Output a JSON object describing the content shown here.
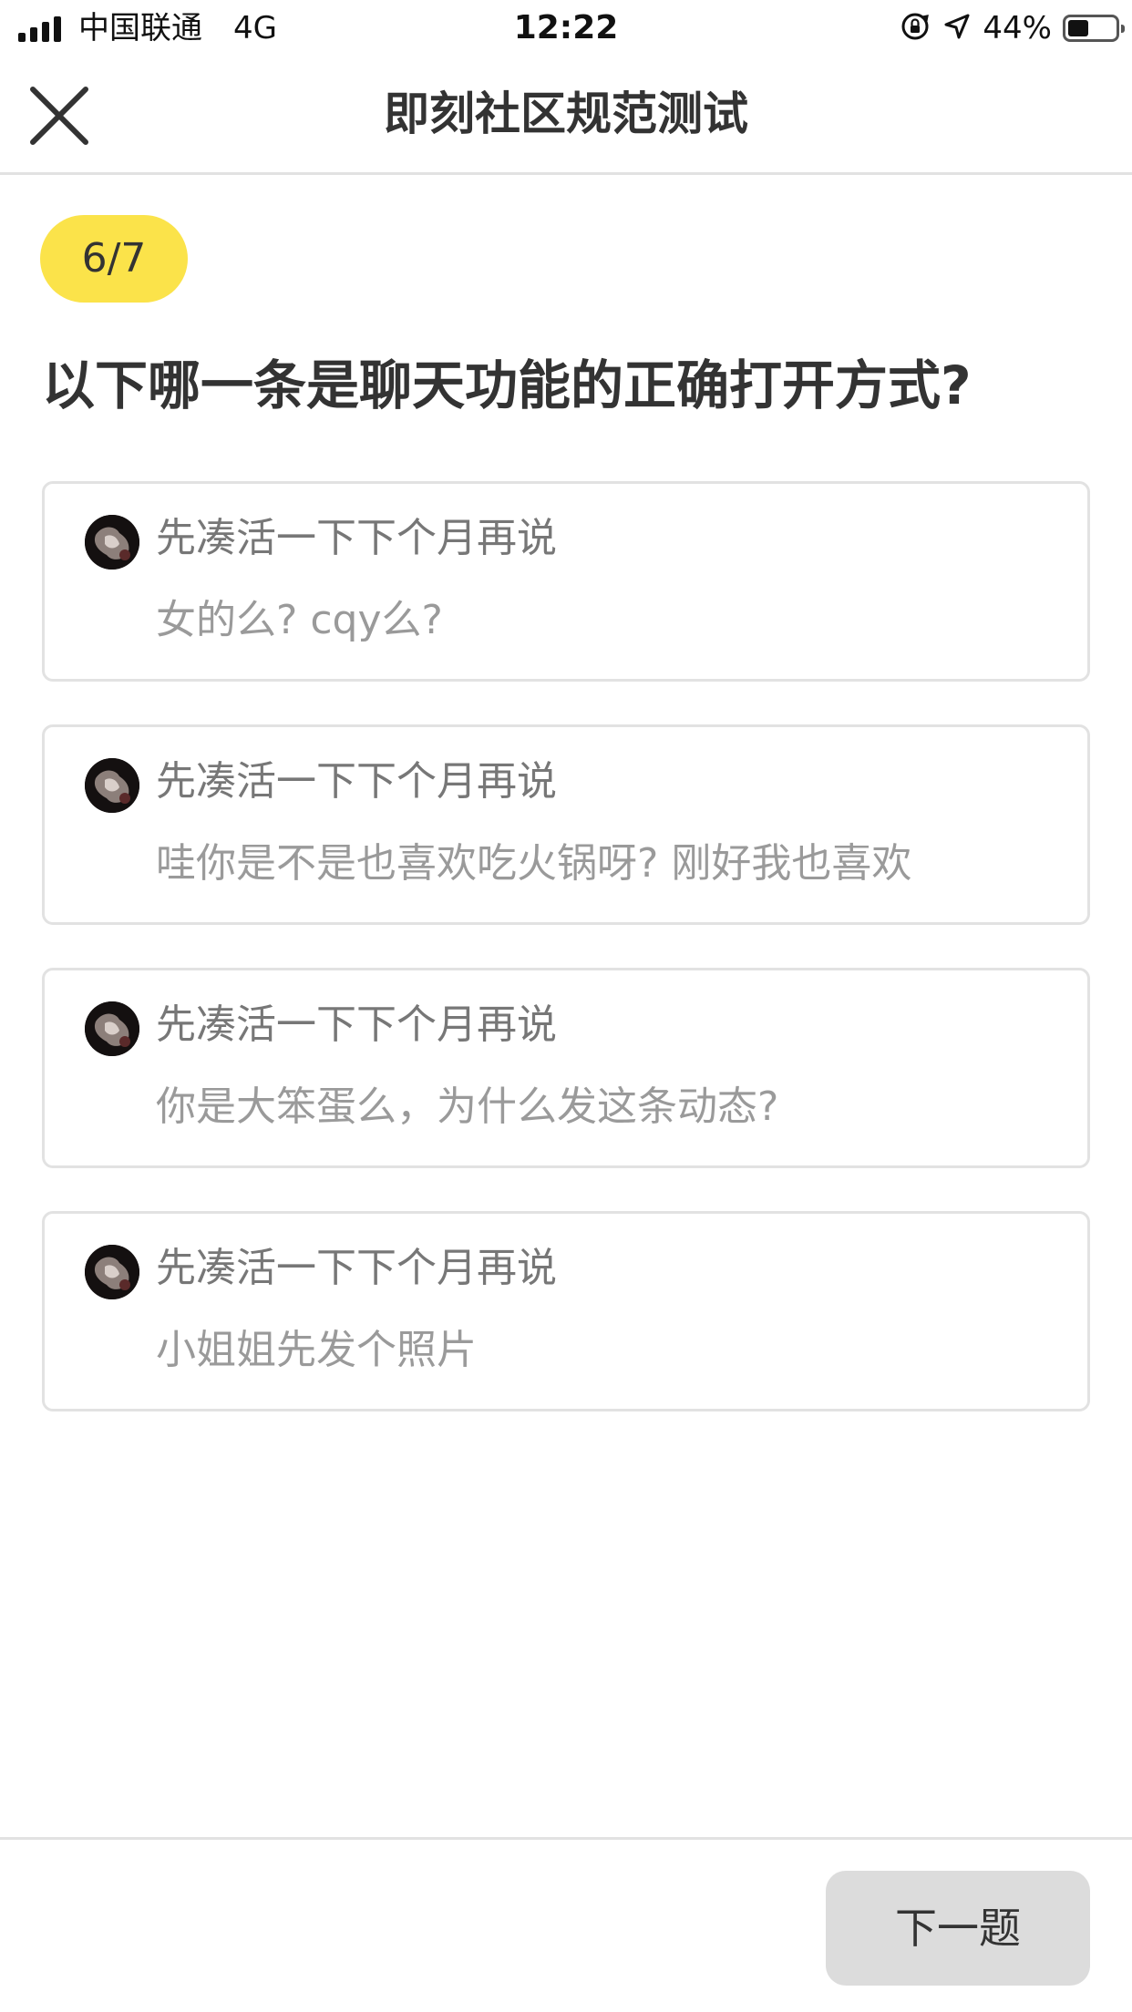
{
  "status_bar": {
    "carrier": "中国联通",
    "network": "4G",
    "time": "12:22",
    "battery_percent": "44%",
    "battery_level": 0.44,
    "icons": [
      "signal-icon",
      "orientation-lock-icon",
      "location-arrow-icon",
      "battery-icon"
    ]
  },
  "nav": {
    "title": "即刻社区规范测试",
    "close_icon": "close-icon"
  },
  "progress": {
    "label": "6/7",
    "current": 6,
    "total": 7
  },
  "question": {
    "text": "以下哪一条是聊天功能的正确打开方式?"
  },
  "options": [
    {
      "name": "先凑活一下下个月再说",
      "message": "女的么? cqy么?"
    },
    {
      "name": "先凑活一下下个月再说",
      "message": "哇你是不是也喜欢吃火锅呀? 刚好我也喜欢"
    },
    {
      "name": "先凑活一下下个月再说",
      "message": "你是大笨蛋么，为什么发这条动态?"
    },
    {
      "name": "先凑活一下下个月再说",
      "message": "小姐姐先发个照片"
    }
  ],
  "footer": {
    "next_label": "下一题"
  },
  "colors": {
    "accent_yellow": "#fbe34a",
    "button_gray": "#dcdcdc",
    "border_gray": "#e2e2e2",
    "text_dark": "#333333",
    "text_muted": "#9a9a9a"
  }
}
